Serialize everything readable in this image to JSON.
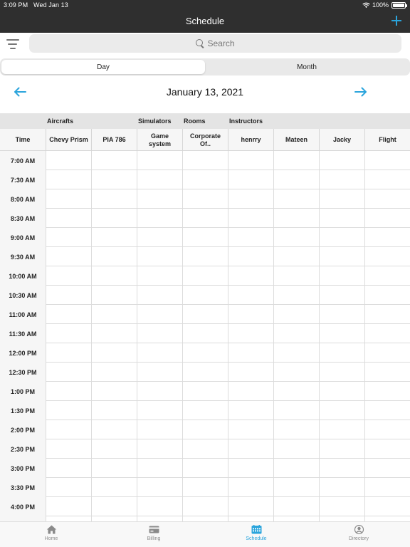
{
  "status": {
    "time": "3:09 PM",
    "date": "Wed Jan 13",
    "battery": "100%",
    "battery_level": 1.0
  },
  "nav": {
    "title": "Schedule",
    "add_icon": "plus-icon"
  },
  "search": {
    "placeholder": "Search",
    "filter_icon": "filter-icon"
  },
  "segment": {
    "options": [
      {
        "label": "Day",
        "active": true
      },
      {
        "label": "Month",
        "active": false
      }
    ]
  },
  "date_header": {
    "date": "January 13, 2021",
    "prev_icon": "arrow-left-icon",
    "next_icon": "arrow-right-icon"
  },
  "grid": {
    "categories": [
      "Aircrafts",
      "Simulators",
      "Rooms",
      "Instructors"
    ],
    "time_header": "Time",
    "columns": [
      "Chevy Prism",
      "PIA 786",
      "Game system",
      "Corporate Of..",
      "henrry",
      "Mateen",
      "Jacky",
      "Flight"
    ],
    "times": [
      "7:00 AM",
      "7:30 AM",
      "8:00 AM",
      "8:30 AM",
      "9:00 AM",
      "9:30 AM",
      "10:00 AM",
      "10:30 AM",
      "11:00 AM",
      "11:30 AM",
      "12:00 PM",
      "12:30 PM",
      "1:00 PM",
      "1:30 PM",
      "2:00 PM",
      "2:30 PM",
      "3:00 PM",
      "3:30 PM",
      "4:00 PM",
      ""
    ]
  },
  "tabs": [
    {
      "label": "Home",
      "icon": "home-icon",
      "active": false
    },
    {
      "label": "Billing",
      "icon": "credit-card-icon",
      "active": false
    },
    {
      "label": "Schedule",
      "icon": "calendar-icon",
      "active": true
    },
    {
      "label": "Directory",
      "icon": "person-circle-icon",
      "active": false
    }
  ],
  "colors": {
    "accent": "#2aa4dc",
    "topbar": "#2f2f2f",
    "grid_line": "#dcdcdc",
    "header_bg": "#e4e4e4"
  }
}
